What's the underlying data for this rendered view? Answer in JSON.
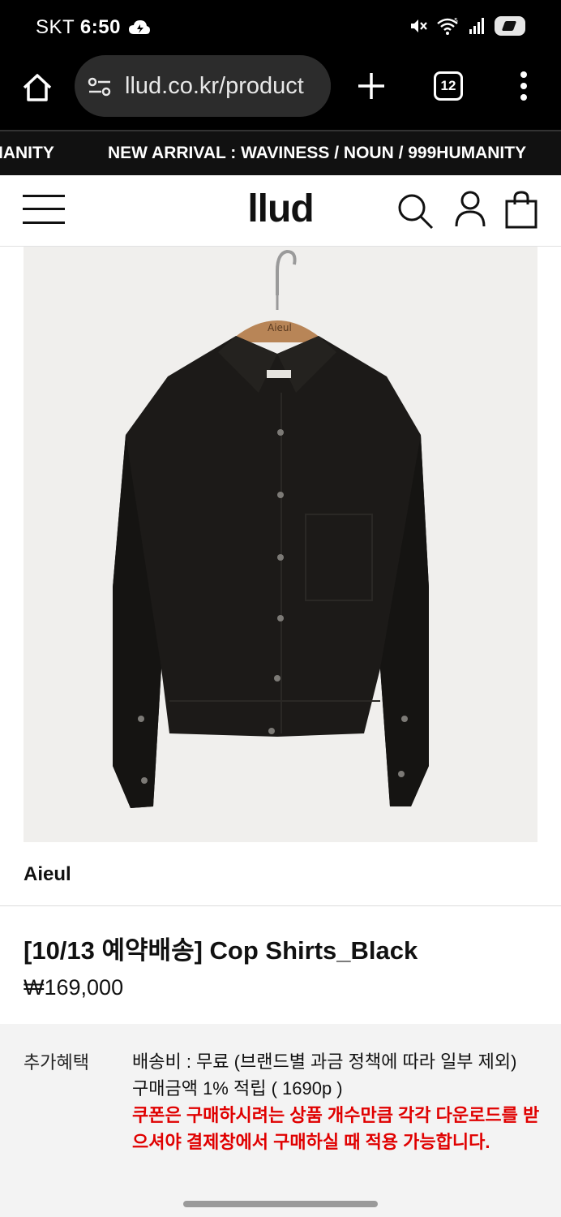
{
  "status_bar": {
    "carrier": "SKT",
    "time": "6:50"
  },
  "browser": {
    "url": "llud.co.kr/product",
    "tab_count": "12"
  },
  "marquee": {
    "left_fragment": "IANITY",
    "text": "NEW ARRIVAL : WAVINESS / NOUN / 999HUMANITY"
  },
  "header": {
    "logo": "llud"
  },
  "product": {
    "hanger_brand": "Aieul",
    "brand": "Aieul",
    "title": "[10/13 예약배송] Cop Shirts_Black",
    "price": "₩169,000"
  },
  "benefits": {
    "label": "추가혜택",
    "shipping": "배송비 : 무료 (브랜드별 과금 정책에 따라 일부 제외)",
    "points": "구매금액 1% 적립 ( 1690p )",
    "coupon_notice": "쿠폰은 구매하시려는 상품 개수만큼 각각 다운로드를 받으셔야 결제창에서 구매하실 때 적용 가능합니다."
  },
  "colors": {
    "status_bg": "#000000",
    "marquee_bg": "#111111",
    "notice_red": "#e00000",
    "benefit_bg": "#f3f3f3"
  }
}
